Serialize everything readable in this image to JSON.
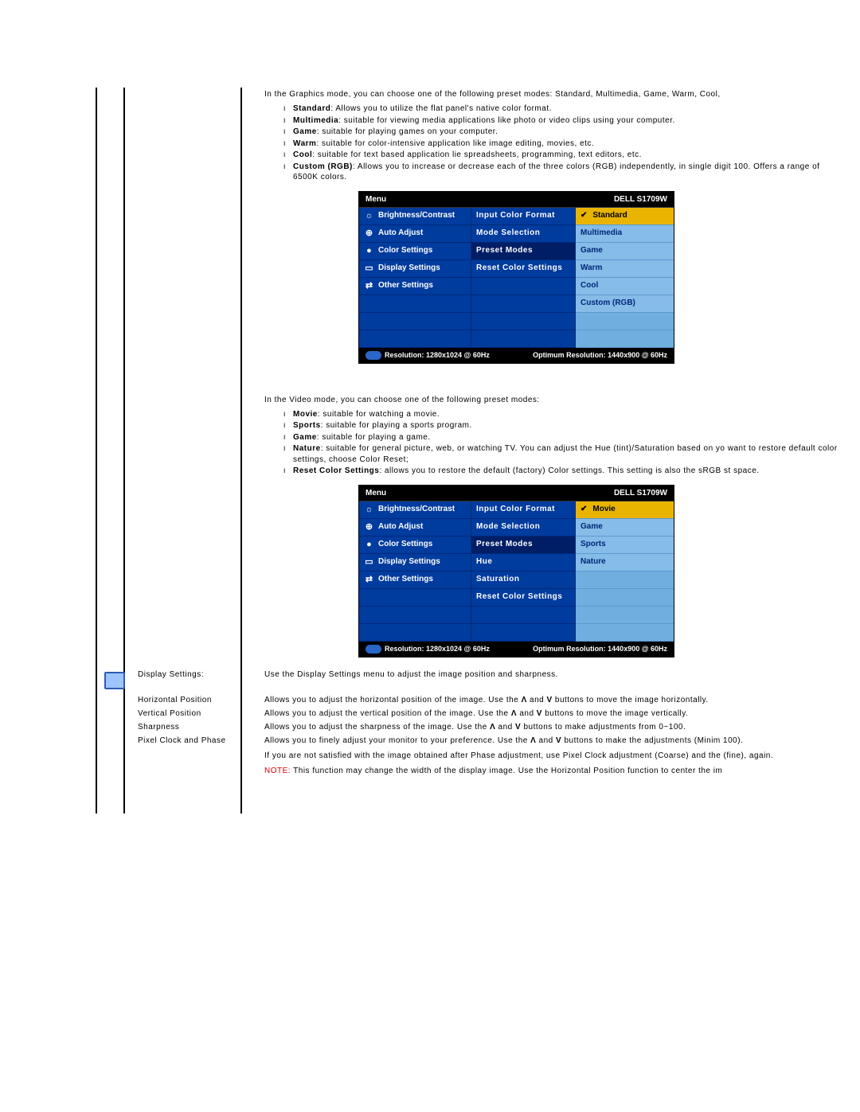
{
  "graphics": {
    "intro": "In the Graphics mode, you can choose one of the following preset modes: Standard, Multimedia, Game, Warm, Cool,",
    "items": [
      {
        "name": "Standard",
        "desc": ": Allows you to utilize the flat panel's native color format."
      },
      {
        "name": "Multimedia",
        "desc": ": suitable for viewing media applications like photo or video clips using your computer."
      },
      {
        "name": "Game",
        "desc": ": suitable for playing games on your computer."
      },
      {
        "name": "Warm",
        "desc": ": suitable for color-intensive application like image editing, movies, etc."
      },
      {
        "name": "Cool",
        "desc": ": suitable for text based application lie spreadsheets, programming, text editors, etc."
      },
      {
        "name": "Custom (RGB)",
        "desc": ": Allows you to increase or decrease each of the three colors (RGB) independently, in single digit 100. Offers a range of 6500K colors."
      }
    ]
  },
  "video": {
    "intro": "In the Video mode, you can choose one of the following preset modes:",
    "items": [
      {
        "name": "Movie",
        "desc": ": suitable for watching a movie."
      },
      {
        "name": "Sports",
        "desc": ": suitable for playing a sports program."
      },
      {
        "name": "Game",
        "desc": ": suitable for playing a game."
      },
      {
        "name": "Nature",
        "desc": ": suitable for general picture, web, or watching TV. You can adjust the Hue (tint)/Saturation based on yo want to restore default color settings, choose Color Reset;"
      },
      {
        "name": "Reset Color Settings",
        "desc": ": allows you to restore the default (factory) Color settings. This setting is also the sRGB st space."
      }
    ]
  },
  "osd_common": {
    "menu_label": "Menu",
    "model": "DELL S1709W",
    "left_items": [
      "Brightness/Contrast",
      "Auto Adjust",
      "Color Settings",
      "Display Settings",
      "Other Settings"
    ],
    "footer_res": "Resolution: 1280x1024 @ 60Hz",
    "footer_opt": "Optimum Resolution: 1440x900 @ 60Hz"
  },
  "osd1": {
    "mid_items": [
      "Input Color Format",
      "Mode Selection",
      "Preset Modes",
      "Reset Color Settings"
    ],
    "right_items": [
      "Standard",
      "Multimedia",
      "Game",
      "Warm",
      "Cool",
      "Custom (RGB)"
    ],
    "right_selected": 0,
    "mid_picked": 2
  },
  "osd2": {
    "mid_items": [
      "Input Color Format",
      "Mode Selection",
      "Preset Modes",
      "Hue",
      "Saturation",
      "Reset Color Settings"
    ],
    "right_items": [
      "Movie",
      "Game",
      "Sports",
      "Nature"
    ],
    "right_selected": 0,
    "mid_picked": 2
  },
  "display_settings": {
    "heading": "Display Settings:",
    "heading_desc": "Use the Display Settings menu to adjust the image position and sharpness.",
    "rows": [
      {
        "label": "Horizontal Position",
        "body_pre": "Allows you to adjust the horizontal position of the image. Use the ",
        "body_mid": " and ",
        "body_post": " buttons to move the image horizontally."
      },
      {
        "label": "Vertical Position",
        "body_pre": "Allows you to adjust the vertical position of the image. Use the ",
        "body_mid": " and ",
        "body_post": " buttons to move the image vertically."
      },
      {
        "label": "Sharpness",
        "body_pre": "Allows you to adjust the sharpness of the image. Use the ",
        "body_mid": " and ",
        "body_post": " buttons to make adjustments from 0~100."
      }
    ],
    "pixel": {
      "label": "Pixel Clock and Phase",
      "p1_pre": "Allows you to finely adjust your monitor to your preference. Use the ",
      "p1_mid": " and ",
      "p1_post": " buttons to make the adjustments (Minim 100).",
      "p2": "If you are not satisfied with the image obtained after Phase adjustment, use Pixel Clock adjustment (Coarse) and the (fine), again.",
      "note_label": "NOTE:",
      "note": " This function may change the width of the display image. Use the Horizontal Position function to center the im"
    },
    "arrows": {
      "up": "Λ",
      "down": "V"
    }
  }
}
